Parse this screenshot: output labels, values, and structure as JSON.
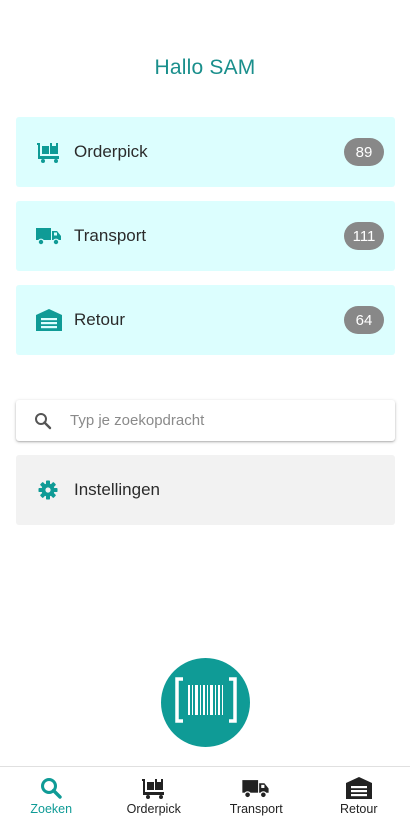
{
  "greeting": "Hallo SAM",
  "colors": {
    "accent": "#0f9b96",
    "card_bg": "#dcfefe",
    "badge_bg": "#888888"
  },
  "menu": [
    {
      "label": "Orderpick",
      "count": "89",
      "icon": "cart-icon"
    },
    {
      "label": "Transport",
      "count": "111",
      "icon": "truck-icon"
    },
    {
      "label": "Retour",
      "count": "64",
      "icon": "warehouse-icon"
    }
  ],
  "search": {
    "placeholder": "Typ je zoekopdracht",
    "value": ""
  },
  "settings": {
    "label": "Instellingen",
    "icon": "gear-icon"
  },
  "scan": {
    "icon": "barcode-scan-icon"
  },
  "bottom_nav": [
    {
      "label": "Zoeken",
      "icon": "search-icon",
      "active": true
    },
    {
      "label": "Orderpick",
      "icon": "cart-icon",
      "active": false
    },
    {
      "label": "Transport",
      "icon": "truck-icon",
      "active": false
    },
    {
      "label": "Retour",
      "icon": "warehouse-icon",
      "active": false
    }
  ]
}
